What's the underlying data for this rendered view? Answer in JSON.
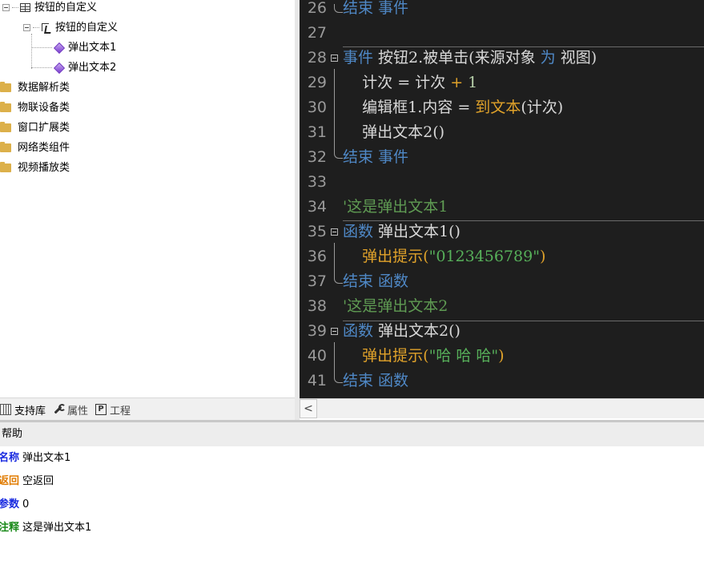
{
  "tree": {
    "root": {
      "label": "按钮的自定义",
      "icon": "grid-icon"
    },
    "child": {
      "label": "按钮的自定义",
      "icon": "button-icon"
    },
    "leaves": [
      {
        "label": "弹出文本1",
        "icon": "method-gem-icon"
      },
      {
        "label": "弹出文本2",
        "icon": "method-gem-icon"
      }
    ],
    "folders": [
      {
        "label": "数据解析类"
      },
      {
        "label": "物联设备类"
      },
      {
        "label": "窗口扩展类"
      },
      {
        "label": "网络类组件"
      },
      {
        "label": "视频播放类"
      }
    ]
  },
  "tabs": [
    {
      "label": "支持库",
      "icon": "library-icon",
      "active": true
    },
    {
      "label": "属性",
      "icon": "wrench-icon",
      "active": false
    },
    {
      "label": "工程",
      "icon": "project-icon",
      "active": false
    }
  ],
  "editor": {
    "lines": [
      {
        "n": "26",
        "tokens": [
          {
            "t": "结束 事件",
            "c": "kw-blue"
          }
        ]
      },
      {
        "n": "27",
        "tokens": []
      },
      {
        "n": "28",
        "tokens": [
          {
            "t": "事件 ",
            "c": "kw-blue"
          },
          {
            "t": "按钮2.被单击(来源对象 ",
            "c": "c-default"
          },
          {
            "t": "为",
            "c": "kw-blue"
          },
          {
            "t": " 视图)",
            "c": "c-default"
          }
        ]
      },
      {
        "n": "29",
        "tokens": [
          {
            "t": "    计次 = 计次 ",
            "c": "c-default"
          },
          {
            "t": "+",
            "c": "c-orange"
          },
          {
            "t": " 1",
            "c": "c-num"
          }
        ]
      },
      {
        "n": "30",
        "tokens": [
          {
            "t": "    编辑框1.内容 = ",
            "c": "c-default"
          },
          {
            "t": "到文本",
            "c": "c-orange"
          },
          {
            "t": "(计次)",
            "c": "c-default"
          }
        ]
      },
      {
        "n": "31",
        "tokens": [
          {
            "t": "    弹出文本2()",
            "c": "c-default"
          }
        ]
      },
      {
        "n": "32",
        "tokens": [
          {
            "t": "结束 事件",
            "c": "kw-blue"
          }
        ]
      },
      {
        "n": "33",
        "tokens": []
      },
      {
        "n": "34",
        "tokens": [
          {
            "t": "'这是弹出文本1",
            "c": "c-comment"
          }
        ]
      },
      {
        "n": "35",
        "tokens": [
          {
            "t": "函数 ",
            "c": "kw-blue"
          },
          {
            "t": "弹出文本1()",
            "c": "c-default"
          }
        ]
      },
      {
        "n": "36",
        "tokens": [
          {
            "t": "    弹出提示(",
            "c": "c-orange"
          },
          {
            "t": "\"0123456789\"",
            "c": "c-green-str"
          },
          {
            "t": ")",
            "c": "c-orange"
          }
        ]
      },
      {
        "n": "37",
        "tokens": [
          {
            "t": "结束 函数",
            "c": "kw-blue"
          }
        ]
      },
      {
        "n": "38",
        "tokens": [
          {
            "t": "'这是弹出文本2",
            "c": "c-comment"
          }
        ]
      },
      {
        "n": "39",
        "tokens": [
          {
            "t": "函数 ",
            "c": "kw-blue"
          },
          {
            "t": "弹出文本2()",
            "c": "c-default"
          }
        ]
      },
      {
        "n": "40",
        "tokens": [
          {
            "t": "    弹出提示(",
            "c": "c-orange"
          },
          {
            "t": "\"哈 哈 哈\"",
            "c": "c-green-str"
          },
          {
            "t": ")",
            "c": "c-orange"
          }
        ]
      },
      {
        "n": "41",
        "tokens": [
          {
            "t": "结束 函数",
            "c": "kw-blue"
          }
        ]
      }
    ]
  },
  "scrollbar": {
    "left_arrow": "<"
  },
  "help": {
    "title": "帮助",
    "rows": [
      {
        "key": "名称",
        "value": "弹出文本1"
      },
      {
        "key": "返回",
        "value": "空返回"
      },
      {
        "key": "参数",
        "value": "0"
      },
      {
        "key": "注释",
        "value": "这是弹出文本1"
      }
    ]
  },
  "colors": {
    "editor_bg": "#1e1e1e",
    "keyword": "#4f88c6",
    "builtin": "#e0a22a",
    "string": "#57b05a",
    "comment": "#5f9b53"
  }
}
